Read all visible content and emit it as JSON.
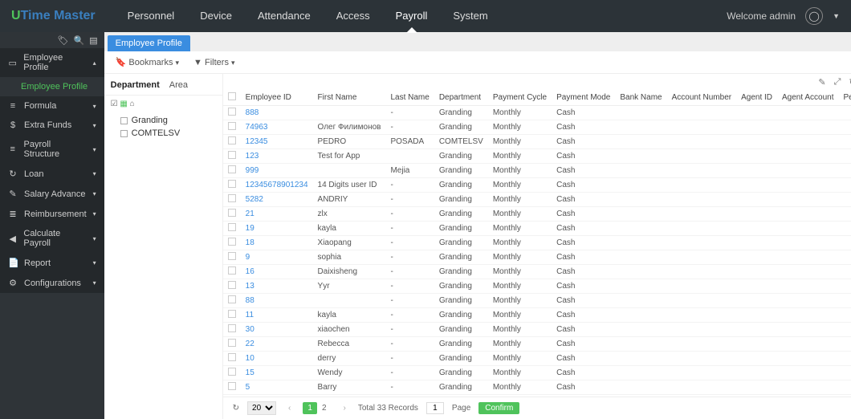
{
  "brand": {
    "u": "U",
    "time": "Time",
    "master": " Master"
  },
  "topnav": [
    "Personnel",
    "Device",
    "Attendance",
    "Access",
    "Payroll",
    "System"
  ],
  "topnav_active": 4,
  "welcome": "Welcome admin",
  "sidebar": [
    {
      "icon": "id",
      "label": "Employee Profile",
      "expanded": true,
      "children": [
        {
          "label": "Employee Profile",
          "active": true
        }
      ]
    },
    {
      "icon": "fn",
      "label": "Formula"
    },
    {
      "icon": "$",
      "label": "Extra Funds"
    },
    {
      "icon": "≡",
      "label": "Payroll Structure"
    },
    {
      "icon": "↻",
      "label": "Loan"
    },
    {
      "icon": "✎",
      "label": "Salary Advance"
    },
    {
      "icon": "≣",
      "label": "Reimbursement"
    },
    {
      "icon": "◀",
      "label": "Calculate Payroll"
    },
    {
      "icon": "📄",
      "label": "Report"
    },
    {
      "icon": "⚙",
      "label": "Configurations"
    }
  ],
  "tab_title": "Employee Profile",
  "toolbar": {
    "bookmarks": "Bookmarks",
    "filters": "Filters"
  },
  "leftpanel": {
    "tabs": [
      "Department",
      "Area"
    ],
    "active": 0,
    "tree": [
      "Granding",
      "COMTELSV"
    ]
  },
  "columns": [
    "Employee ID",
    "First Name",
    "Last Name",
    "Department",
    "Payment Cycle",
    "Payment Mode",
    "Bank Name",
    "Account Number",
    "Agent ID",
    "Agent Account",
    "Personnel ID"
  ],
  "rows": [
    {
      "id": "888",
      "fn": "",
      "ln": "-",
      "dept": "Granding",
      "cycle": "Monthly",
      "mode": "Cash"
    },
    {
      "id": "74963",
      "fn": "Олег Филимонов",
      "ln": "-",
      "dept": "Granding",
      "cycle": "Monthly",
      "mode": "Cash"
    },
    {
      "id": "12345",
      "fn": "PEDRO",
      "ln": "POSADA",
      "dept": "COMTELSV",
      "cycle": "Monthly",
      "mode": "Cash"
    },
    {
      "id": "123",
      "fn": "Test for App",
      "ln": "",
      "dept": "Granding",
      "cycle": "Monthly",
      "mode": "Cash"
    },
    {
      "id": "999",
      "fn": "",
      "ln": "Mejia",
      "dept": "Granding",
      "cycle": "Monthly",
      "mode": "Cash"
    },
    {
      "id": "12345678901234",
      "fn": "14 Digits user ID",
      "ln": "-",
      "dept": "Granding",
      "cycle": "Monthly",
      "mode": "Cash"
    },
    {
      "id": "5282",
      "fn": "ANDRIY",
      "ln": "-",
      "dept": "Granding",
      "cycle": "Monthly",
      "mode": "Cash"
    },
    {
      "id": "21",
      "fn": "zlx",
      "ln": "-",
      "dept": "Granding",
      "cycle": "Monthly",
      "mode": "Cash"
    },
    {
      "id": "19",
      "fn": "kayla",
      "ln": "-",
      "dept": "Granding",
      "cycle": "Monthly",
      "mode": "Cash"
    },
    {
      "id": "18",
      "fn": "Xiaopang",
      "ln": "-",
      "dept": "Granding",
      "cycle": "Monthly",
      "mode": "Cash"
    },
    {
      "id": "9",
      "fn": "sophia",
      "ln": "-",
      "dept": "Granding",
      "cycle": "Monthly",
      "mode": "Cash"
    },
    {
      "id": "16",
      "fn": "Daixisheng",
      "ln": "-",
      "dept": "Granding",
      "cycle": "Monthly",
      "mode": "Cash"
    },
    {
      "id": "13",
      "fn": "Yyr",
      "ln": "-",
      "dept": "Granding",
      "cycle": "Monthly",
      "mode": "Cash"
    },
    {
      "id": "88",
      "fn": "",
      "ln": "-",
      "dept": "Granding",
      "cycle": "Monthly",
      "mode": "Cash"
    },
    {
      "id": "11",
      "fn": "kayla",
      "ln": "-",
      "dept": "Granding",
      "cycle": "Monthly",
      "mode": "Cash"
    },
    {
      "id": "30",
      "fn": "xiaochen",
      "ln": "-",
      "dept": "Granding",
      "cycle": "Monthly",
      "mode": "Cash"
    },
    {
      "id": "22",
      "fn": "Rebecca",
      "ln": "-",
      "dept": "Granding",
      "cycle": "Monthly",
      "mode": "Cash"
    },
    {
      "id": "10",
      "fn": "derry",
      "ln": "-",
      "dept": "Granding",
      "cycle": "Monthly",
      "mode": "Cash"
    },
    {
      "id": "15",
      "fn": "Wendy",
      "ln": "-",
      "dept": "Granding",
      "cycle": "Monthly",
      "mode": "Cash"
    },
    {
      "id": "5",
      "fn": "Barry",
      "ln": "-",
      "dept": "Granding",
      "cycle": "Monthly",
      "mode": "Cash"
    }
  ],
  "footer": {
    "page_size": "20",
    "pages": [
      "1",
      "2"
    ],
    "active_page": 0,
    "total": "Total 33 Records",
    "goto": "1",
    "page_label": "Page",
    "confirm": "Confirm"
  }
}
